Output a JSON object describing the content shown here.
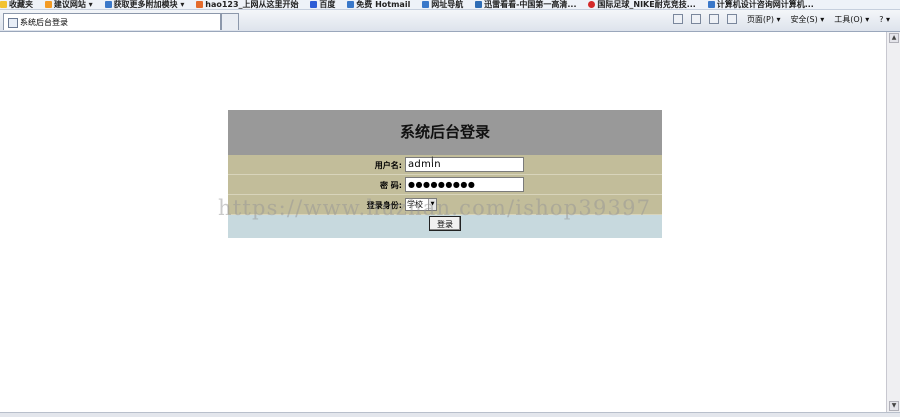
{
  "favorites_bar": {
    "items": [
      {
        "label": "收藏夹",
        "icon": "star-icon"
      },
      {
        "label": "建议网站 ▾",
        "icon": "web-slice-icon"
      },
      {
        "label": "获取更多附加模块 ▾",
        "icon": "ie-page-icon"
      },
      {
        "label": "hao123_上网从这里开始",
        "icon": "hao-icon"
      },
      {
        "label": "百度",
        "icon": "baidu-icon"
      },
      {
        "label": "免费 Hotmail",
        "icon": "ie-page-icon"
      },
      {
        "label": "网址导航",
        "icon": "ie-page-icon"
      },
      {
        "label": "迅雷看看-中国第一高清...",
        "icon": "xunlei-icon"
      },
      {
        "label": "国际足球_NIKE耐克竞技...",
        "icon": "nike-icon"
      },
      {
        "label": "计算机设计咨询网计算机...",
        "icon": "ie-page-icon"
      }
    ]
  },
  "tab": {
    "title": "系统后台登录"
  },
  "command_bar": {
    "page_label": "页面(P) ▾",
    "safety_label": "安全(S) ▾",
    "tools_label": "工具(O) ▾",
    "help_label": "? ▾"
  },
  "login": {
    "title": "系统后台登录",
    "username_label": "用户名:",
    "username_value": "admin",
    "password_label": "密 码:",
    "password_value": "●●●●●●●●●",
    "role_label": "登录身份:",
    "role_value": "学校",
    "submit_label": "登录"
  },
  "watermark": "https://www.huzhan.com/ishop39397",
  "colors": {
    "header_bg": "#999999",
    "row_bg": "#c2bd9a",
    "footer_bg": "#c7d9de"
  }
}
